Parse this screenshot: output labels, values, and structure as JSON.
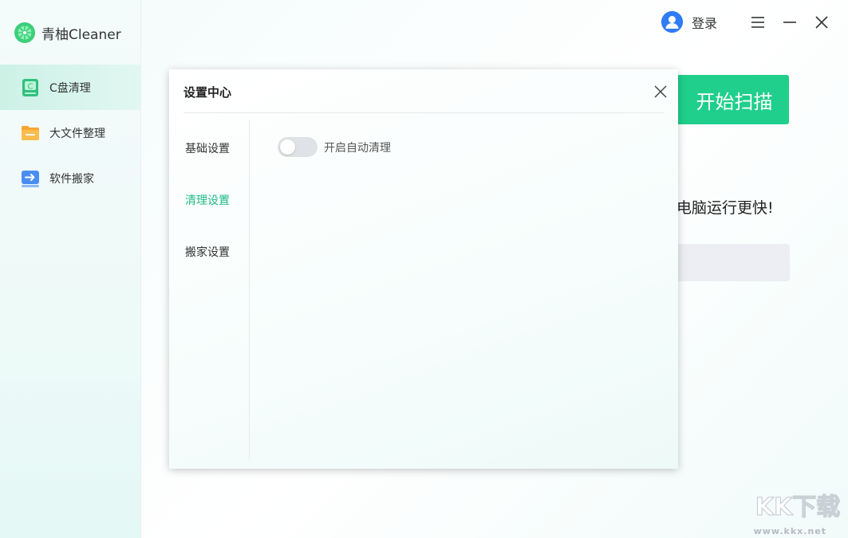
{
  "app": {
    "brand_name": "青柚Cleaner",
    "accent_color": "#1fcf8b"
  },
  "sidebar": {
    "items": [
      {
        "label": "C盘清理",
        "icon": "disk-icon",
        "active": true
      },
      {
        "label": "大文件整理",
        "icon": "folder-icon",
        "active": false
      },
      {
        "label": "软件搬家",
        "icon": "move-icon",
        "active": false
      }
    ]
  },
  "topbar": {
    "login_label": "登录",
    "icons": [
      "user-avatar-icon",
      "menu-icon",
      "minimize-icon",
      "close-icon"
    ]
  },
  "main": {
    "scan_button": "开始扫描",
    "slogan": "电脑运行更快!"
  },
  "settings_dialog": {
    "title": "设置中心",
    "menu": [
      {
        "label": "基础设置",
        "active": false
      },
      {
        "label": "清理设置",
        "active": true
      },
      {
        "label": "搬家设置",
        "active": false
      }
    ],
    "auto_clean": {
      "label": "开启自动清理",
      "enabled": false
    }
  },
  "watermark": {
    "logo_text": "KK下载",
    "url": "www.kkx.net"
  }
}
